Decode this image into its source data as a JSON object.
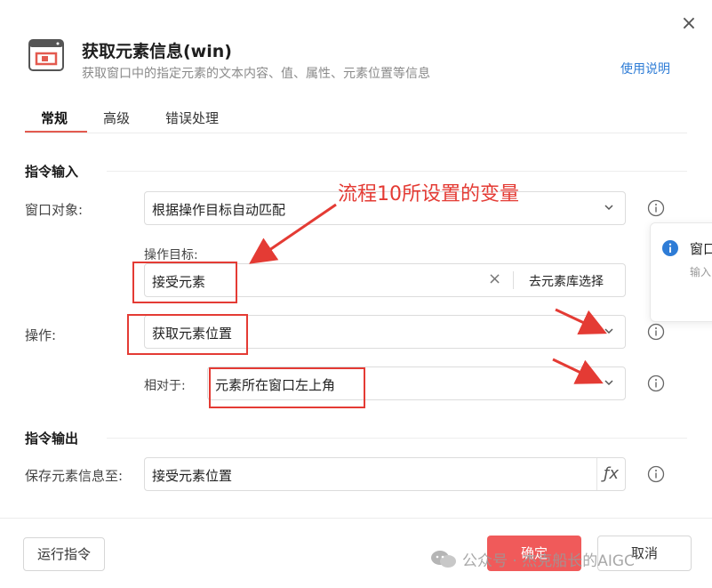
{
  "header": {
    "title": "获取元素信息(win)",
    "subtitle": "获取窗口中的指定元素的文本内容、值、属性、元素位置等信息",
    "help_link": "使用说明",
    "close": "×"
  },
  "tabs": [
    {
      "label": "常规",
      "active": true
    },
    {
      "label": "高级",
      "active": false
    },
    {
      "label": "错误处理",
      "active": false
    }
  ],
  "input_section": {
    "title": "指令输入",
    "window_label": "窗口对象:",
    "window_value": "根据操作目标自动匹配",
    "target_label": "操作目标:",
    "target_value": "接受元素",
    "clear_symbol": "×",
    "target_select_button": "去元素库选择",
    "operation_label": "操作:",
    "operation_value": "获取元素位置",
    "relative_label": "相对于:",
    "relative_value": "元素所在窗口左上角"
  },
  "output_section": {
    "title": "指令输出",
    "save_label": "保存元素信息至:",
    "save_value": "接受元素位置",
    "fx_symbol": "ƒx"
  },
  "annotation": {
    "text": "流程10所设置的变量"
  },
  "tooltip": {
    "title": "窗口",
    "desc": "输入"
  },
  "footer": {
    "run_button": "运行指令",
    "confirm_button": "确定",
    "cancel_button": "取消"
  },
  "watermark": {
    "text": "公众号 · 杰克船长的AIGC"
  },
  "colors": {
    "accent": "#e35a4f",
    "primary_button": "#f05a5a",
    "link": "#2e7cd6",
    "annotation": "#e43b34"
  },
  "icons": [
    "window-element-icon",
    "close-icon",
    "chevron-down-icon",
    "info-icon",
    "clear-icon",
    "fx-icon",
    "wechat-icon"
  ]
}
